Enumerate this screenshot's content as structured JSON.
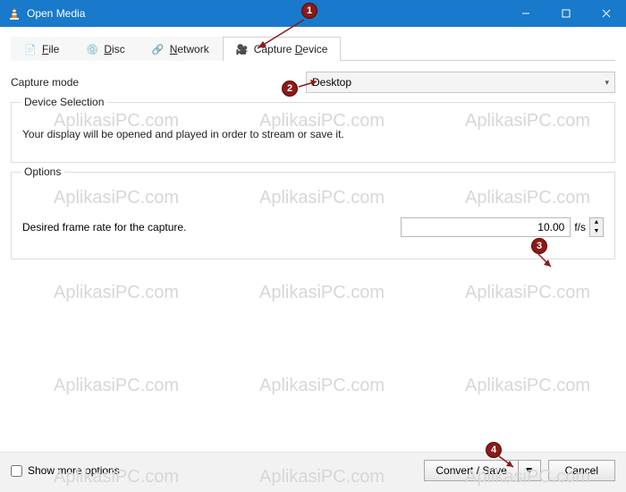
{
  "window": {
    "title": "Open Media"
  },
  "tabs": {
    "file": "File",
    "disc": "Disc",
    "network": "Network",
    "capture": "Capture Device"
  },
  "capture_mode": {
    "label": "Capture mode",
    "value": "Desktop"
  },
  "device_selection": {
    "legend": "Device Selection",
    "desc": "Your display will be opened and played in order to stream or save it."
  },
  "options": {
    "legend": "Options",
    "frame_label": "Desired frame rate for the capture.",
    "frame_value": "10.00",
    "frame_unit": "f/s"
  },
  "footer": {
    "show_more": "Show more options",
    "convert": "Convert / Save",
    "cancel": "Cancel"
  },
  "ann": {
    "b1": "1",
    "b2": "2",
    "b3": "3",
    "b4": "4"
  },
  "watermark": "AplikasiPC.com"
}
